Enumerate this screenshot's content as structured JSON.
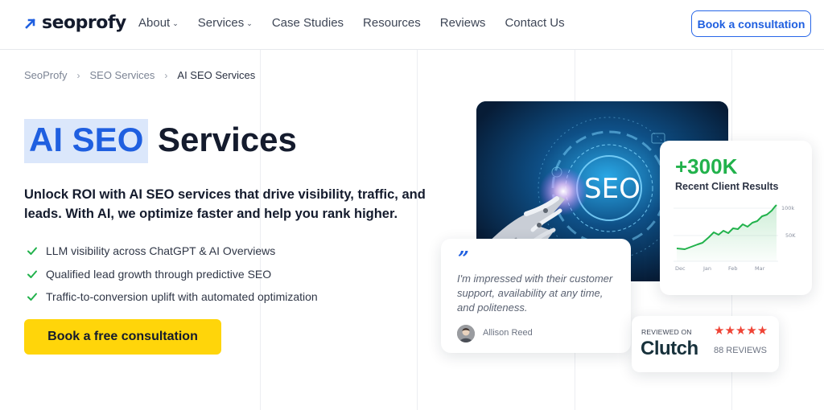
{
  "header": {
    "logo_text": "seoprofy",
    "nav": [
      {
        "label": "About",
        "has_dropdown": true
      },
      {
        "label": "Services",
        "has_dropdown": true
      },
      {
        "label": "Case Studies",
        "has_dropdown": false
      },
      {
        "label": "Resources",
        "has_dropdown": false
      },
      {
        "label": "Reviews",
        "has_dropdown": false
      },
      {
        "label": "Contact Us",
        "has_dropdown": false
      }
    ],
    "cta_label": "Book a consultation"
  },
  "breadcrumb": [
    "SeoProfy",
    "SEO Services",
    "AI SEO Services"
  ],
  "hero": {
    "title_highlight": "AI SEO",
    "title_rest": "Services",
    "subtitle": "Unlock ROI with AI SEO services that drive visibility, traffic, and leads. With AI, we optimize faster and help you rank higher.",
    "bullets": [
      "LLM visibility across ChatGPT & AI Overviews",
      "Qualified lead growth through predictive SEO",
      "Traffic-to-conversion uplift with automated optimization"
    ],
    "cta_label": "Book a free consultation"
  },
  "image_card": {
    "image_text": "SEO"
  },
  "stats_card": {
    "value": "+300K",
    "label": "Recent Client Results",
    "y_ticks": [
      "100k",
      "50K"
    ],
    "x_ticks": [
      "Dec",
      "Jan",
      "Feb",
      "Mar"
    ]
  },
  "testimonial": {
    "quote_mark": "”",
    "text": "I'm impressed with their customer support, availability at any time, and politeness.",
    "author": "Allison Reed"
  },
  "clutch": {
    "reviewed_on": "REVIEWED ON",
    "logo": "Clutch",
    "stars": "★★★★★",
    "reviews": "88 REVIEWS"
  },
  "colors": {
    "brand_blue": "#1f5fe0",
    "cta_yellow": "#ffd50a",
    "success_green": "#22b24c",
    "star_red": "#ef4335"
  }
}
